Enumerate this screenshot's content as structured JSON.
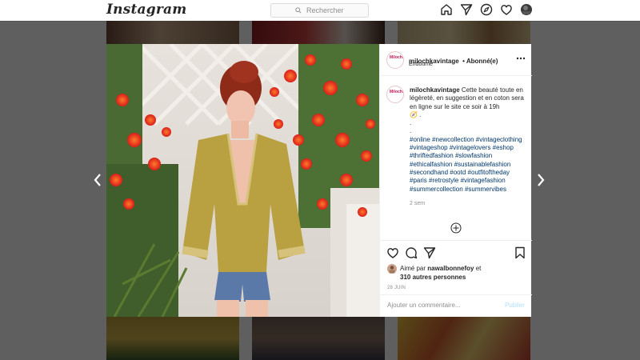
{
  "app": {
    "logo_text": "Instagram",
    "search_placeholder": "Rechercher",
    "nav_icons": [
      "home-icon",
      "direct-icon",
      "explore-icon",
      "heart-icon",
      "profile-avatar"
    ]
  },
  "post": {
    "username": "milochkavintage",
    "follow_status": "• Abonné(e)",
    "location": "Endoume",
    "avatar_text": "Milochka",
    "caption_text": " Cette beauté toute en légèreté, en suggestion et en coton sera en ligne sur le site ce soir à 19h",
    "caption_emoji": "🧭 .",
    "dots": [
      ".",
      "."
    ],
    "hashtags": [
      "#online",
      "#newcollection",
      "#vintageclothing",
      "#vintageshop",
      "#vintagelovers",
      "#eshop",
      "#thriftedfashion",
      "#slowfashion",
      "#ethicalfashion",
      "#sustainablefashion",
      "#secondhand",
      "#ootd",
      "#outfitoftheday",
      "#paris",
      "#retrostyle",
      "#vintagefashion",
      "#summercollection",
      "#summervibes"
    ],
    "caption_time": "2 sem",
    "liked_by_prefix": "Aimé par",
    "liked_by_user": "nawalbonnefoy",
    "liked_by_and": "et",
    "liked_by_others": "310 autres personnes",
    "post_date": "28 JUIN",
    "comment_placeholder": "Ajouter un commentaire...",
    "publish_label": "Publier"
  },
  "colors": {
    "link": "#00376b",
    "publish": "#b2dffc",
    "muted": "#8e8e8e",
    "overlay": "rgba(0,0,0,0.62)"
  }
}
